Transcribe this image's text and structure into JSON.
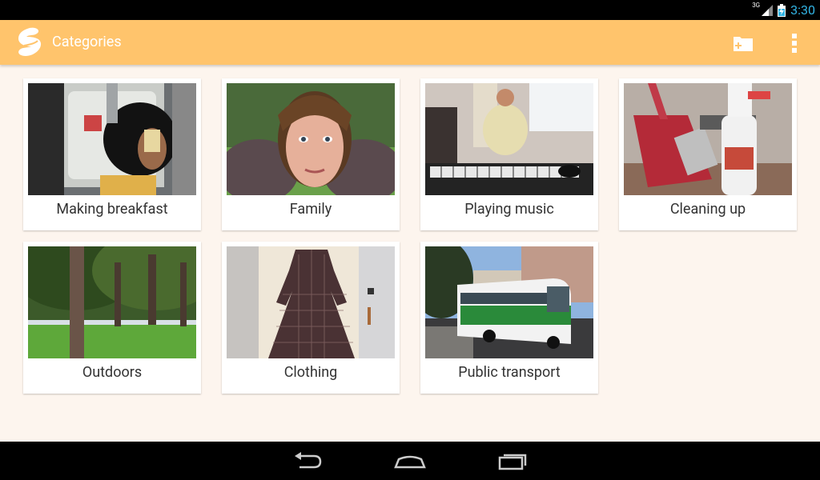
{
  "status_bar": {
    "network": "3G",
    "time": "3:30"
  },
  "action_bar": {
    "title": "Categories",
    "icons": [
      "app-logo",
      "add-folder-icon",
      "overflow-menu-icon"
    ]
  },
  "categories": [
    {
      "label": "Making breakfast"
    },
    {
      "label": "Family"
    },
    {
      "label": "Playing music"
    },
    {
      "label": "Cleaning up"
    },
    {
      "label": "Outdoors"
    },
    {
      "label": "Clothing"
    },
    {
      "label": "Public transport"
    }
  ],
  "nav_bar": {
    "icons": [
      "back-icon",
      "home-icon",
      "recent-apps-icon"
    ]
  },
  "colors": {
    "action_bar": "#ffc46c",
    "background": "#fdf5ee",
    "status_accent": "#33b5e5"
  }
}
